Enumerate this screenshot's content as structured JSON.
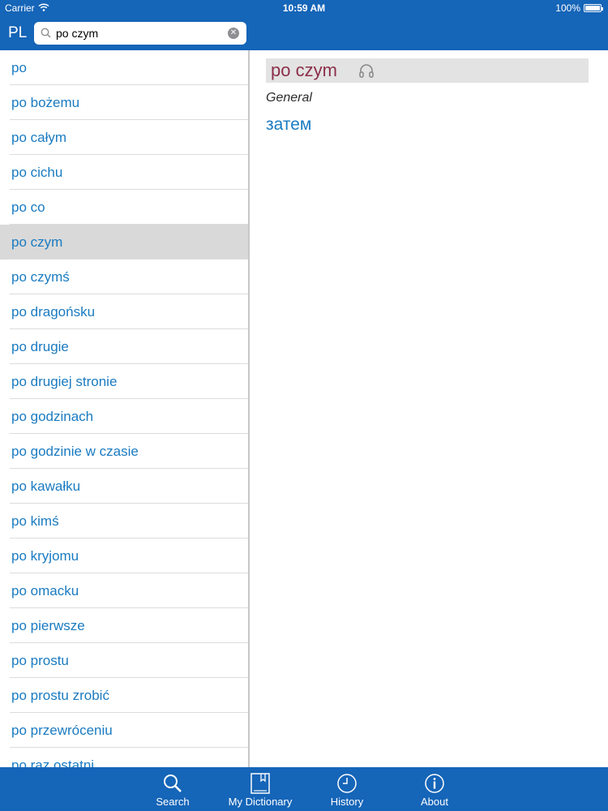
{
  "status_bar": {
    "carrier": "Carrier",
    "time": "10:59 AM",
    "battery": "100%"
  },
  "search": {
    "language": "PL",
    "query": "po czym"
  },
  "word_list": [
    "po",
    "po bożemu",
    "po całym",
    "po cichu",
    "po co",
    "po czym",
    "po czymś",
    "po dragońsku",
    "po drugie",
    "po drugiej stronie",
    "po godzinach",
    "po godzinie w czasie",
    "po kawałku",
    "po kimś",
    "po kryjomu",
    "po omacku",
    "po pierwsze",
    "po prostu",
    "po prostu zrobić",
    "po przewróceniu",
    "po raz ostatni"
  ],
  "selected_index": 5,
  "detail": {
    "headword": "po czym",
    "category": "General",
    "translation": "затем"
  },
  "tabs": [
    {
      "label": "Search",
      "icon": "search-icon"
    },
    {
      "label": "My Dictionary",
      "icon": "book-icon"
    },
    {
      "label": "History",
      "icon": "clock-icon"
    },
    {
      "label": "About",
      "icon": "info-icon"
    }
  ],
  "colors": {
    "bar": "#1565b8",
    "link": "#1a7bc1",
    "headword": "#8b2f4a",
    "selected_row": "#d9d9d9"
  }
}
